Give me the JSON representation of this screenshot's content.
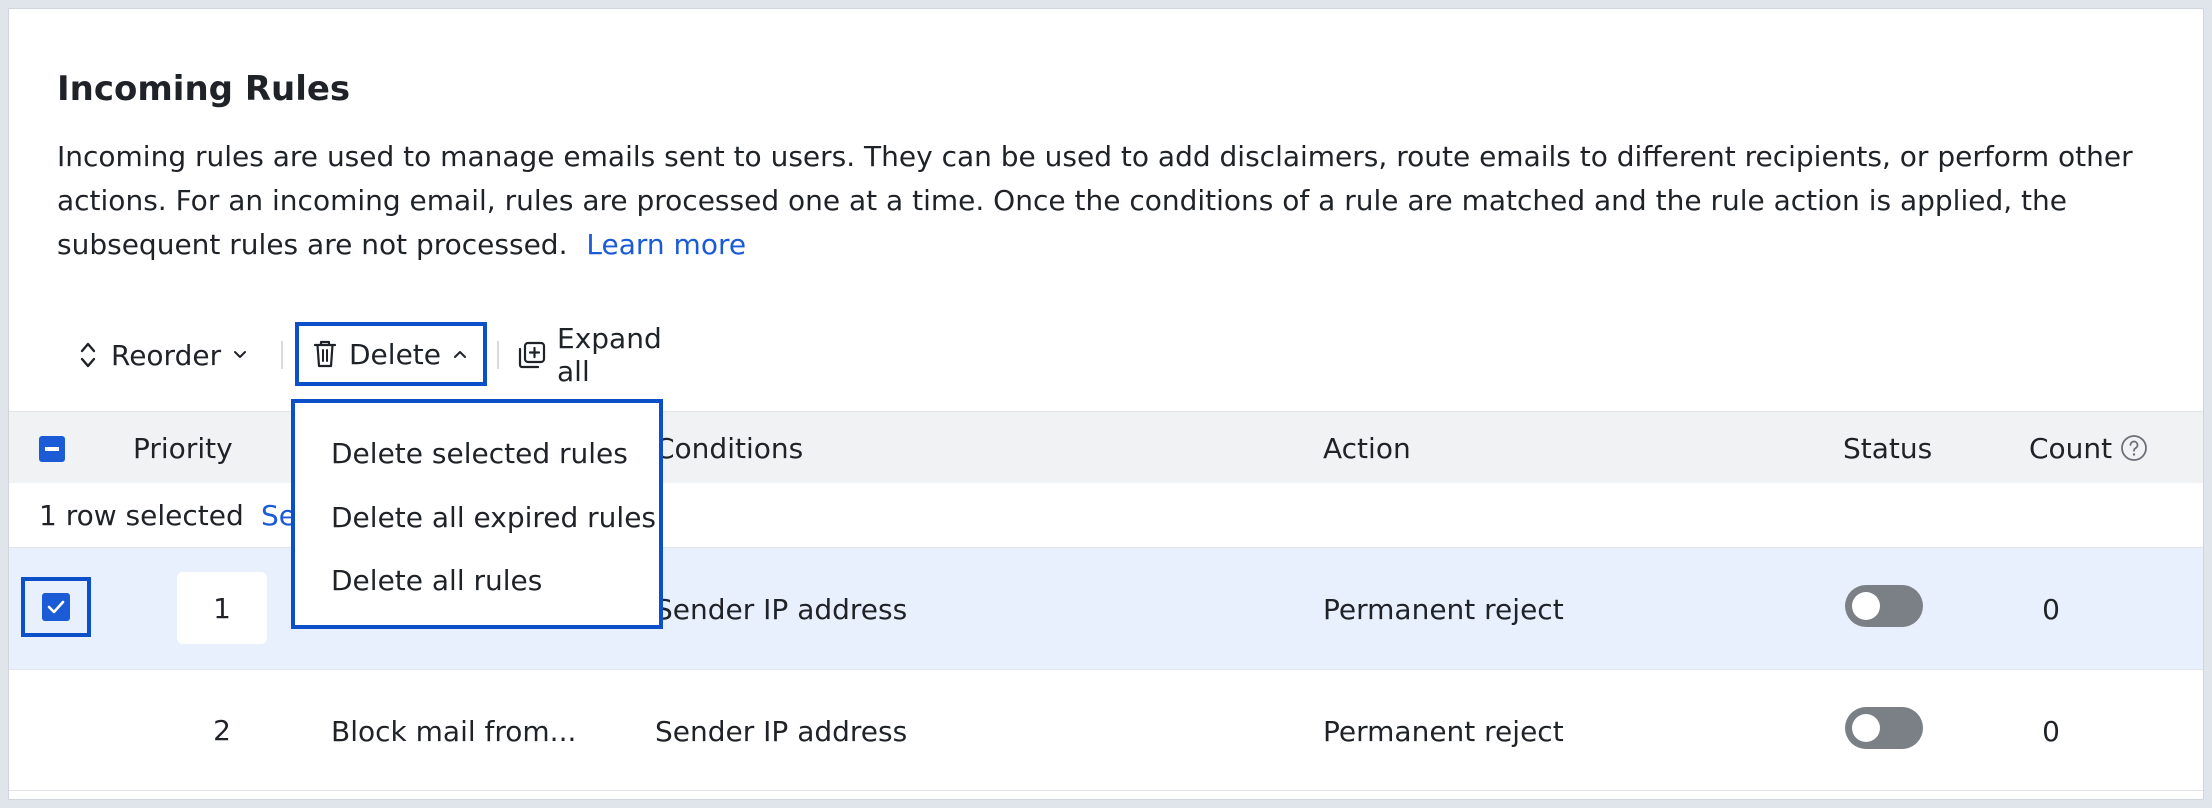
{
  "page": {
    "title": "Incoming Rules",
    "description": "Incoming rules are used to manage emails sent to users. They can be used to add disclaimers, route emails to different recipients, or perform other actions. For an incoming email, rules are processed one at a time. Once the conditions of a rule are matched and the rule action is applied, the subsequent rules are not processed.",
    "learn_more": "Learn more"
  },
  "toolbar": {
    "reorder_label": "Reorder",
    "delete_label": "Delete",
    "expand_label": "Expand all"
  },
  "delete_menu": {
    "items": [
      "Delete selected rules",
      "Delete all expired rules",
      "Delete all rules"
    ]
  },
  "table": {
    "headers": {
      "priority": "Priority",
      "conditions": "Conditions",
      "action": "Action",
      "status": "Status",
      "count": "Count"
    },
    "selection_text": "1 row selected",
    "select_all_partial": "Se",
    "rows": [
      {
        "priority": "1",
        "name": "",
        "conditions": "Sender IP address",
        "action": "Permanent reject",
        "status_on": false,
        "count": "0",
        "selected": true
      },
      {
        "priority": "2",
        "name": "Block mail from...",
        "conditions": "Sender IP address",
        "action": "Permanent reject",
        "status_on": false,
        "count": "0",
        "selected": false
      }
    ]
  },
  "colors": {
    "accent": "#1c5bd6",
    "highlight_border": "#0b4fc9",
    "selected_row_bg": "#e9f0fd",
    "header_bg": "#f1f2f4",
    "toggle_off": "#7b7f86"
  },
  "icons": {
    "reorder": "sort-up-down-icon",
    "delete": "trash-icon",
    "expand": "expand-plus-icon",
    "count_help": "question-circle-icon"
  }
}
